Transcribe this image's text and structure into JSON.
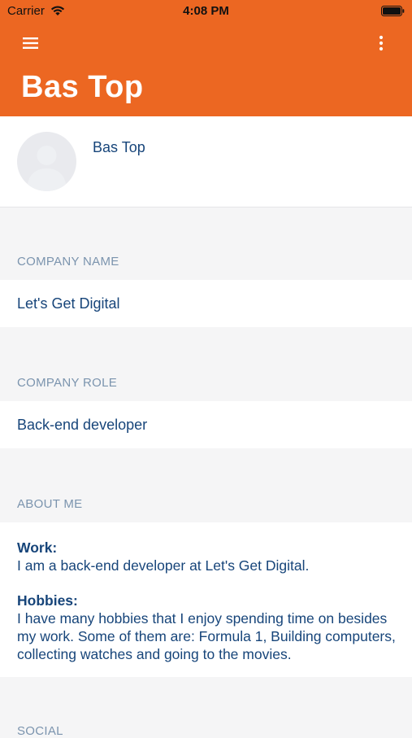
{
  "status": {
    "carrier": "Carrier",
    "time": "4:08 PM",
    "accent": "#ec6722"
  },
  "header": {
    "title": "Bas Top"
  },
  "profile": {
    "name": "Bas Top"
  },
  "company_name": {
    "label": "COMPANY NAME",
    "value": "Let's Get Digital"
  },
  "company_role": {
    "label": "COMPANY ROLE",
    "value": "Back-end developer"
  },
  "about": {
    "label": "ABOUT ME",
    "work_heading": "Work:",
    "work_text": "I am a back-end developer at Let's Get Digital.",
    "hobbies_heading": "Hobbies:",
    "hobbies_text": "I have many hobbies that I enjoy spending time on besides my work. Some of them are: Formula 1, Building computers, collecting watches and going to the movies."
  },
  "social": {
    "label": "SOCIAL"
  },
  "icons": {
    "menu": "menu-icon",
    "more": "more-vertical-icon",
    "wifi": "wifi-icon",
    "battery": "battery-icon",
    "avatar": "avatar-placeholder-icon"
  }
}
